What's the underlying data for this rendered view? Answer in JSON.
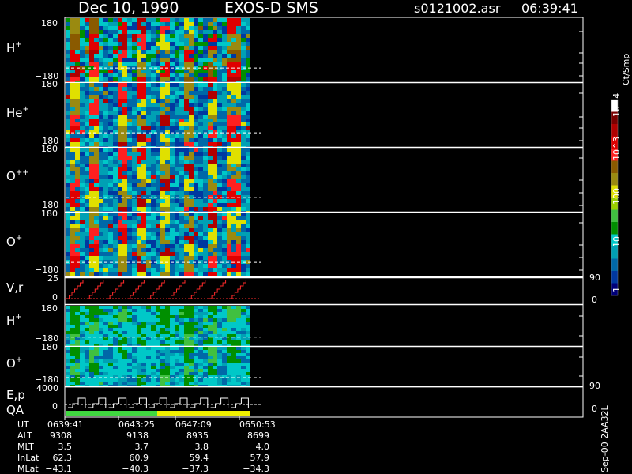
{
  "header": {
    "date": "Dec 10, 1990",
    "instrument": "EXOS-D SMS",
    "file": "s0121002.asr",
    "time": "06:39:41"
  },
  "colorbar": {
    "unit": "Ct/Smp",
    "labels": [
      "10^4",
      "10^3",
      "100",
      "10",
      "1"
    ],
    "colors": [
      "#ffffff",
      "#7a0000",
      "#b00000",
      "#e00000",
      "#ff2020",
      "#8a5a00",
      "#9a8a10",
      "#e0e000",
      "#9ad000",
      "#40c040",
      "#008f00",
      "#00c8c8",
      "#00a0b4",
      "#0068a8",
      "#0038a0",
      "#000078"
    ]
  },
  "panels": [
    {
      "id": "h-plus",
      "label": "H",
      "sup": "+",
      "ymax": "180",
      "ymin": "−180",
      "kind": "hot"
    },
    {
      "id": "he-plus",
      "label": "He",
      "sup": "+",
      "ymax": "180",
      "ymin": "−180",
      "kind": "medium"
    },
    {
      "id": "o-plusplus",
      "label": "O",
      "sup": "++",
      "ymax": "180",
      "ymin": "−180",
      "kind": "medium"
    },
    {
      "id": "o-plus",
      "label": "O",
      "sup": "+",
      "ymax": "180",
      "ymin": "−180",
      "kind": "medium"
    },
    {
      "id": "vr",
      "label": "V,r",
      "ymax": "25",
      "ymin": "0",
      "right_top": "90",
      "right_bottom": "0"
    },
    {
      "id": "h-plus-2",
      "label": "H",
      "sup": "+",
      "ymax": "180",
      "ymin": "−180",
      "kind": "cool"
    },
    {
      "id": "o-plus-2",
      "label": "O",
      "sup": "+",
      "ymax": "180",
      "ymin": "−180",
      "kind": "cool2"
    },
    {
      "id": "ep",
      "label": "E,p",
      "label2": "QA",
      "ymax": "4000",
      "ymin": "0",
      "right_top": "90",
      "right_bottom": "0"
    }
  ],
  "chart_data": {
    "type": "heatmap",
    "title": "Dec 10, 1990   EXOS-D SMS",
    "x_axis": "UT",
    "colorbar_unit": "Ct/Smp",
    "colorbar_scale": "log",
    "colorbar_range": [
      1,
      10000
    ],
    "panel_y_ranges": {
      "H+": [
        -180,
        180
      ],
      "He+": [
        -180,
        180
      ],
      "O++": [
        -180,
        180
      ],
      "O+": [
        -180,
        180
      ],
      "V,r": [
        0,
        25
      ],
      "E,p": [
        0,
        4000
      ]
    },
    "data_coverage_ut": [
      "0639:41",
      "0650:53"
    ],
    "table": {
      "columns": [
        "UT",
        "ALT",
        "MLT",
        "InLat",
        "MLat"
      ],
      "rows": [
        [
          "0639:41",
          "9308",
          "3.5",
          "62.3",
          "−43.1"
        ],
        [
          "0643:25",
          "9138",
          "3.7",
          "60.9",
          "−40.3"
        ],
        [
          "0647:09",
          "8935",
          "3.8",
          "59.4",
          "−37.3"
        ],
        [
          "0650:53",
          "8699",
          "4.0",
          "57.9",
          "−34.3"
        ]
      ]
    }
  },
  "footer": {
    "row_labels": [
      "UT",
      "ALT",
      "MLT",
      "InLat",
      "MLat"
    ],
    "side_text": "Sep-00 2AA32L"
  }
}
